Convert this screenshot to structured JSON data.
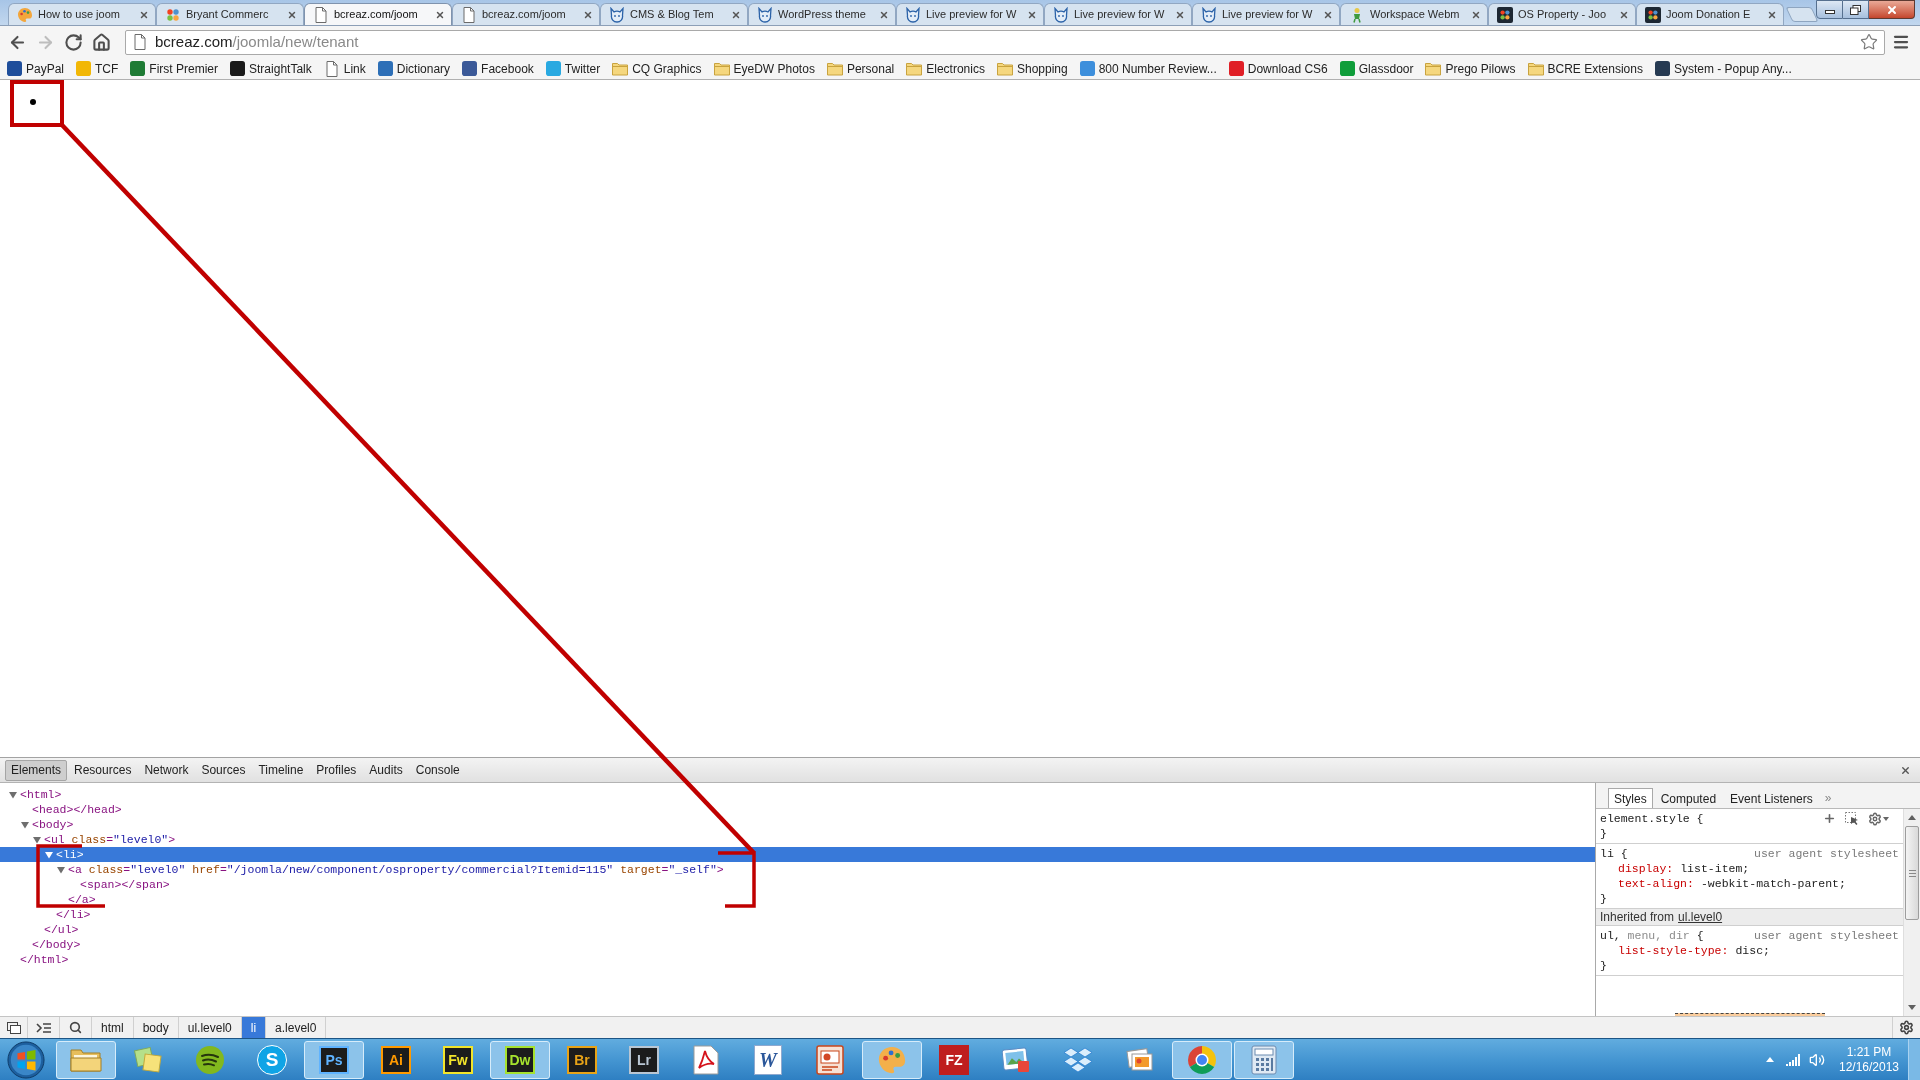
{
  "browser": {
    "tabs": [
      {
        "title": "How to use joom",
        "kind": "palette",
        "selected": false
      },
      {
        "title": "Bryant Commerc",
        "kind": "dots",
        "selected": false
      },
      {
        "title": "bcreaz.com/joom",
        "kind": "page",
        "selected": true
      },
      {
        "title": "bcreaz.com/joom",
        "kind": "page",
        "selected": false
      },
      {
        "title": "CMS & Blog Tem",
        "kind": "cat",
        "selected": false
      },
      {
        "title": "WordPress theme",
        "kind": "cat",
        "selected": false
      },
      {
        "title": "Live preview for W",
        "kind": "cat",
        "selected": false
      },
      {
        "title": "Live preview for W",
        "kind": "cat",
        "selected": false
      },
      {
        "title": "Live preview for W",
        "kind": "cat",
        "selected": false
      },
      {
        "title": "Workspace Webm",
        "kind": "figure",
        "selected": false
      },
      {
        "title": "OS Property - Joo",
        "kind": "dots-tile",
        "selected": false
      },
      {
        "title": "Joom Donation E",
        "kind": "dots-tile",
        "selected": false
      }
    ],
    "nav_buttons": [
      {
        "kind": "back",
        "disabled": false
      },
      {
        "kind": "forward",
        "disabled": true
      },
      {
        "kind": "reload",
        "disabled": false
      },
      {
        "kind": "home",
        "disabled": false
      }
    ],
    "address": {
      "host": "bcreaz.com",
      "path": "/joomla/new/tenant",
      "bookmarked": false
    },
    "bookmarks": [
      {
        "label": "PayPal",
        "kind": "site",
        "color": "#1f4e9b"
      },
      {
        "label": "TCF",
        "kind": "site",
        "color": "#f2b705"
      },
      {
        "label": "First Premier",
        "kind": "site",
        "color": "#1e7b34"
      },
      {
        "label": "StraightTalk",
        "kind": "site",
        "color": "#1a1a1a"
      },
      {
        "label": "Link",
        "kind": "page"
      },
      {
        "label": "Dictionary",
        "kind": "site",
        "color": "#2d6fb7"
      },
      {
        "label": "Facebook",
        "kind": "site",
        "color": "#3b5998"
      },
      {
        "label": "Twitter",
        "kind": "site",
        "color": "#29a9e1"
      },
      {
        "label": "CQ Graphics",
        "kind": "folder"
      },
      {
        "label": "EyeDW Photos",
        "kind": "folder"
      },
      {
        "label": "Personal",
        "kind": "folder"
      },
      {
        "label": "Electronics",
        "kind": "folder"
      },
      {
        "label": "Shopping",
        "kind": "folder"
      },
      {
        "label": "800 Number Review...",
        "kind": "site",
        "color": "#3d8fdc"
      },
      {
        "label": "Download CS6",
        "kind": "site",
        "color": "#e01f26"
      },
      {
        "label": "Glassdoor",
        "kind": "site",
        "color": "#0f9d3a"
      },
      {
        "label": "Prego Pilows",
        "kind": "folder"
      },
      {
        "label": "BCRE Extensions",
        "kind": "folder"
      },
      {
        "label": "System - Popup Any...",
        "kind": "site",
        "color": "#263a52"
      }
    ]
  },
  "devtools": {
    "tabs": [
      {
        "label": "Elements",
        "selected": true
      },
      {
        "label": "Resources",
        "selected": false
      },
      {
        "label": "Network",
        "selected": false
      },
      {
        "label": "Sources",
        "selected": false
      },
      {
        "label": "Timeline",
        "selected": false
      },
      {
        "label": "Profiles",
        "selected": false
      },
      {
        "label": "Audits",
        "selected": false
      },
      {
        "label": "Console",
        "selected": false
      }
    ],
    "dom_tree": [
      {
        "open": "<html>",
        "close": "</html>",
        "expanded": true,
        "selected": false,
        "children": [
          {
            "open": "<head></head>",
            "selected": false
          },
          {
            "open": "<body>",
            "close": "</body>",
            "expanded": true,
            "selected": false,
            "children": [
              {
                "open": "<ul class=\"level0\">",
                "close": "</ul>",
                "expanded": true,
                "selected": false,
                "children": [
                  {
                    "open": "<li>",
                    "close": "</li>",
                    "expanded": true,
                    "selected": true,
                    "children": [
                      {
                        "open": "<a class=\"level0\" href=\"/joomla/new/component/osproperty/commercial?Itemid=115\" target=\"_self\">",
                        "close": "</a>",
                        "expanded": true,
                        "selected": false,
                        "children": [
                          {
                            "open": "<span></span>",
                            "selected": false
                          }
                        ]
                      }
                    ]
                  }
                ]
              }
            ]
          }
        ]
      }
    ],
    "styles": {
      "tabs": [
        {
          "label": "Styles",
          "selected": true
        },
        {
          "label": "Computed",
          "selected": false
        },
        {
          "label": "Event Listeners",
          "selected": false
        }
      ],
      "more": "»",
      "rules": [
        {
          "kind": "element",
          "selector": [
            {
              "text": "element.style {",
              "matched": true
            }
          ],
          "close": "}"
        },
        {
          "kind": "rule",
          "selector": [
            {
              "text": "li {",
              "matched": true
            }
          ],
          "origin": "user agent stylesheet",
          "properties": [
            {
              "name": "display:",
              "value": "list-item;"
            },
            {
              "name": "text-align:",
              "value": "-webkit-match-parent;"
            }
          ],
          "close": "}"
        },
        {
          "kind": "inherited",
          "label": "Inherited from",
          "link": "ul.level0"
        },
        {
          "kind": "rule",
          "selector": [
            {
              "text": "ul, ",
              "matched": true
            },
            {
              "text": "menu, dir",
              "matched": false
            },
            {
              "text": " {",
              "matched": true
            }
          ],
          "origin": "user agent stylesheet",
          "properties": [
            {
              "name": "list-style-type:",
              "value": "disc;"
            }
          ],
          "close": "}"
        }
      ]
    },
    "breadcrumbs": [
      {
        "label": "html",
        "selected": false
      },
      {
        "label": "body",
        "selected": false
      },
      {
        "label": "ul.level0",
        "selected": false
      },
      {
        "label": "li",
        "selected": true
      },
      {
        "label": "a.level0",
        "selected": false
      }
    ]
  },
  "taskbar": {
    "items": [
      {
        "kind": "folder",
        "running": true
      },
      {
        "kind": "notes",
        "running": false
      },
      {
        "kind": "waves",
        "running": false
      },
      {
        "kind": "cloud",
        "label": "S",
        "running": false
      },
      {
        "kind": "tile",
        "label": "Ps",
        "color": "#5fb3ff",
        "running": true
      },
      {
        "kind": "tile",
        "label": "Ai",
        "color": "#ff9a00",
        "running": false
      },
      {
        "kind": "tile",
        "label": "Fw",
        "color": "#f2e52b",
        "running": false
      },
      {
        "kind": "tile",
        "label": "Dw",
        "color": "#a6e22e",
        "running": true
      },
      {
        "kind": "tile",
        "label": "Br",
        "color": "#e8a317",
        "running": false
      },
      {
        "kind": "tile",
        "label": "Lr",
        "color": "#b9c6d3",
        "running": false
      },
      {
        "kind": "pdf",
        "running": false
      },
      {
        "kind": "doc",
        "label": "W",
        "color": "#2b579a",
        "running": false
      },
      {
        "kind": "slides",
        "running": false
      },
      {
        "kind": "palette",
        "running": true
      },
      {
        "kind": "badge",
        "label": "FZ",
        "color": "#bf1e1e",
        "running": false
      },
      {
        "kind": "photo",
        "running": false
      },
      {
        "kind": "dropbox",
        "running": false
      },
      {
        "kind": "photos",
        "running": false
      },
      {
        "kind": "chrome",
        "running": true
      },
      {
        "kind": "calculator",
        "running": true
      }
    ],
    "clock": {
      "time": "1:21 PM",
      "date": "12/16/2013"
    }
  }
}
